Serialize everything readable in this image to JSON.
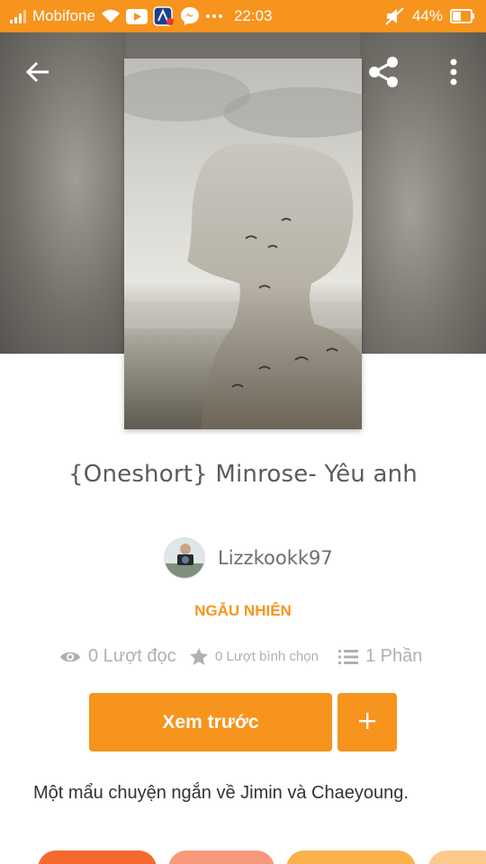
{
  "status_bar": {
    "carrier": "Mobifone",
    "time": "22:03",
    "battery": "44%",
    "icons": [
      "signal-icon",
      "wifi-icon",
      "youtube-icon",
      "app-icon",
      "messenger-icon",
      "more-dots-icon",
      "mute-icon",
      "battery-icon"
    ]
  },
  "header": {
    "back_icon": "arrow-left-icon",
    "share_icon": "share-icon",
    "more_icon": "more-vertical-icon"
  },
  "story": {
    "title": "{Oneshort} Minrose- Yêu anh",
    "author": "Lizzkookk97",
    "category": "NGẪU NHIÊN",
    "stats": {
      "reads": "0 Lượt đọc",
      "votes": "0 Lượt bình chọn",
      "parts": "1 Phần"
    },
    "read_button": "Xem trước",
    "add_button": "+",
    "description": "Một mẩu chuyện ngắn về Jimin và Chaeyoung."
  },
  "colors": {
    "accent": "#f7941d",
    "muted": "#b0b0b0",
    "title": "#5b5b5b"
  }
}
